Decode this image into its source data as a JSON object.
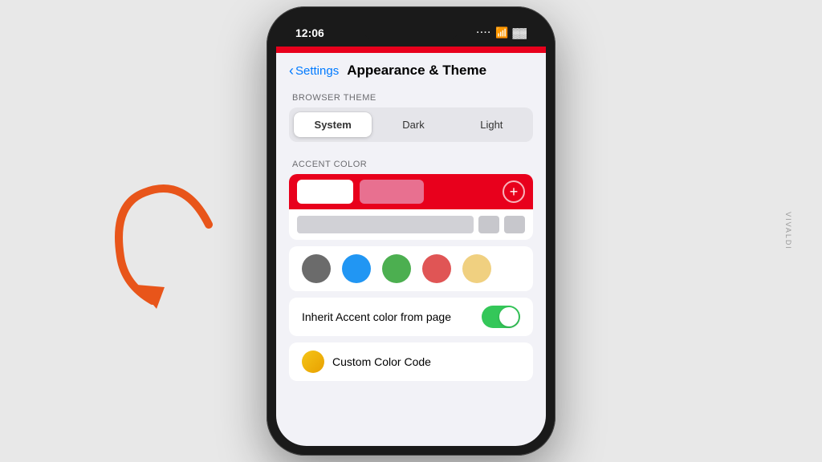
{
  "page": {
    "background_color": "#e8e8e8"
  },
  "status_bar": {
    "time": "12:06",
    "icons": [
      "signal",
      "wifi",
      "battery"
    ]
  },
  "nav": {
    "back_label": "Settings",
    "page_title": "Appearance & Theme"
  },
  "browser_theme": {
    "section_label": "BROWSER THEME",
    "options": [
      "System",
      "Dark",
      "Light"
    ],
    "active": "System"
  },
  "accent_color": {
    "section_label": "ACCENT COLOR",
    "add_button_label": "+"
  },
  "color_circles": [
    {
      "color": "#6b6b6b",
      "name": "gray"
    },
    {
      "color": "#2196f3",
      "name": "blue"
    },
    {
      "color": "#4caf50",
      "name": "green"
    },
    {
      "color": "#e05555",
      "name": "red"
    },
    {
      "color": "#f0d080",
      "name": "yellow"
    }
  ],
  "inherit_toggle": {
    "label": "Inherit Accent color from page",
    "enabled": true
  },
  "custom_color": {
    "label": "Custom Color Code"
  },
  "vivaldi_label": "VIVALDI",
  "arrow_color": "#e8551a"
}
